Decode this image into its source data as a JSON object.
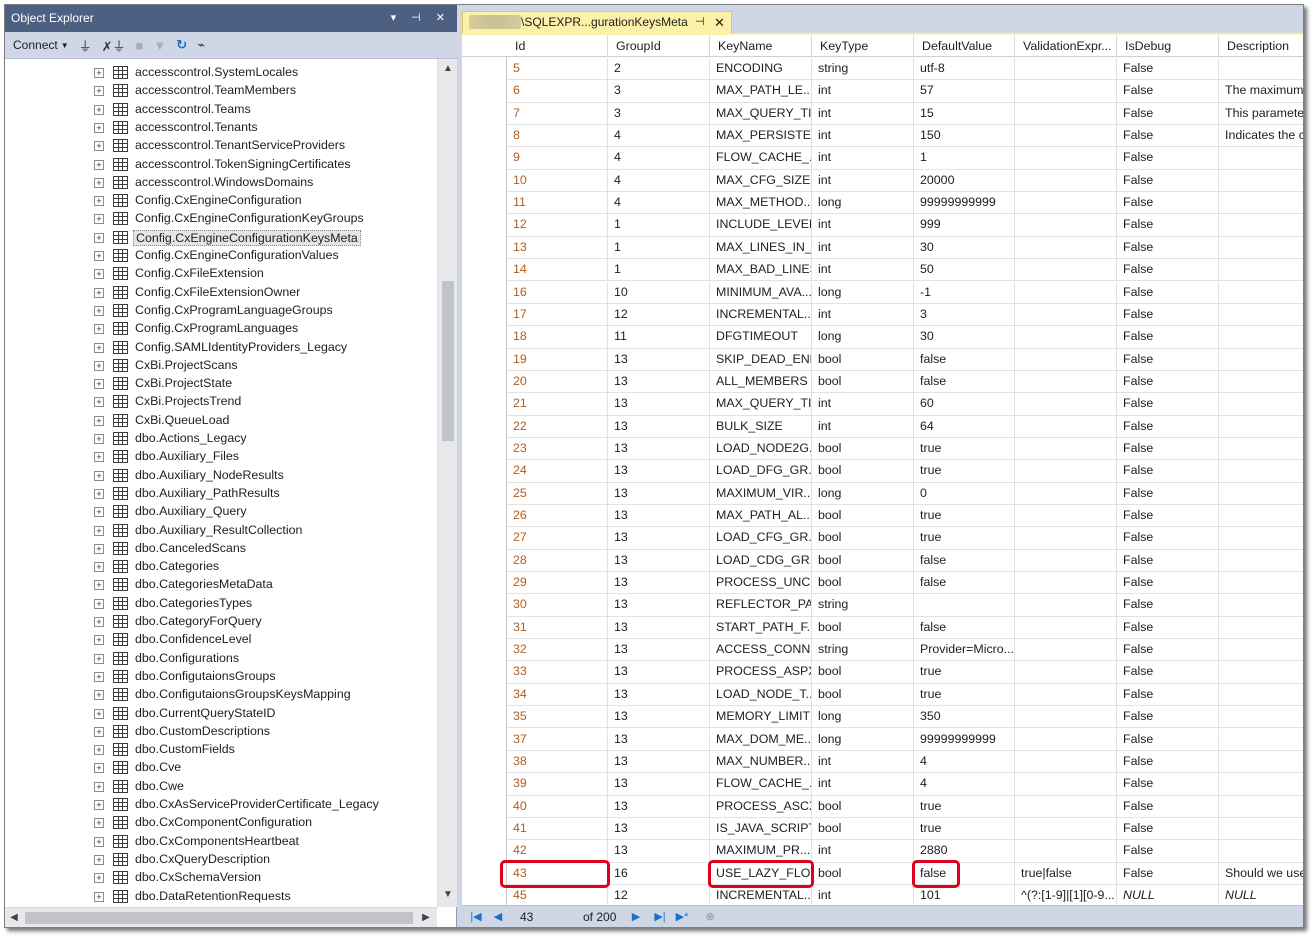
{
  "object_explorer": {
    "title": "Object Explorer",
    "title_controls": "▾ ⊣ ✕",
    "connect_label": "Connect",
    "tree_items": [
      "accesscontrol.SystemLocales",
      "accesscontrol.TeamMembers",
      "accesscontrol.Teams",
      "accesscontrol.Tenants",
      "accesscontrol.TenantServiceProviders",
      "accesscontrol.TokenSigningCertificates",
      "accesscontrol.WindowsDomains",
      "Config.CxEngineConfiguration",
      "Config.CxEngineConfigurationKeyGroups",
      "Config.CxEngineConfigurationKeysMeta",
      "Config.CxEngineConfigurationValues",
      "Config.CxFileExtension",
      "Config.CxFileExtensionOwner",
      "Config.CxProgramLanguageGroups",
      "Config.CxProgramLanguages",
      "Config.SAMLIdentityProviders_Legacy",
      "CxBi.ProjectScans",
      "CxBi.ProjectState",
      "CxBi.ProjectsTrend",
      "CxBi.QueueLoad",
      "dbo.Actions_Legacy",
      "dbo.Auxiliary_Files",
      "dbo.Auxiliary_NodeResults",
      "dbo.Auxiliary_PathResults",
      "dbo.Auxiliary_Query",
      "dbo.Auxiliary_ResultCollection",
      "dbo.CanceledScans",
      "dbo.Categories",
      "dbo.CategoriesMetaData",
      "dbo.CategoriesTypes",
      "dbo.CategoryForQuery",
      "dbo.ConfidenceLevel",
      "dbo.Configurations",
      "dbo.ConfigutaionsGroups",
      "dbo.ConfigutaionsGroupsKeysMapping",
      "dbo.CurrentQueryStateID",
      "dbo.CustomDescriptions",
      "dbo.CustomFields",
      "dbo.Cve",
      "dbo.Cwe",
      "dbo.CxAsServiceProviderCertificate_Legacy",
      "dbo.CxComponentConfiguration",
      "dbo.CxComponentsHeartbeat",
      "dbo.CxQueryDescription",
      "dbo.CxSchemaVersion",
      "dbo.DataRetentionRequests"
    ],
    "selected_item": "Config.CxEngineConfigurationKeysMeta"
  },
  "document": {
    "tab_title": "\\SQLEXPR...gurationKeysMeta",
    "columns": [
      "Id",
      "GroupId",
      "KeyName",
      "KeyType",
      "DefaultValue",
      "ValidationExpr...",
      "IsDebug",
      "Description"
    ],
    "rows": [
      [
        "5",
        "2",
        "ENCODING",
        "string",
        "utf-8",
        "",
        "False",
        ""
      ],
      [
        "6",
        "3",
        "MAX_PATH_LE...",
        "int",
        "57",
        "",
        "False",
        "The maximum"
      ],
      [
        "7",
        "3",
        "MAX_QUERY_TI...",
        "int",
        "15",
        "",
        "False",
        "This parameter"
      ],
      [
        "8",
        "4",
        "MAX_PERSISTE...",
        "int",
        "150",
        "",
        "False",
        "Indicates the ca"
      ],
      [
        "9",
        "4",
        "FLOW_CACHE_...",
        "int",
        "1",
        "",
        "False",
        ""
      ],
      [
        "10",
        "4",
        "MAX_CFG_SIZE",
        "int",
        "20000",
        "",
        "False",
        ""
      ],
      [
        "11",
        "4",
        "MAX_METHOD...",
        "long",
        "99999999999",
        "",
        "False",
        ""
      ],
      [
        "12",
        "1",
        "INCLUDE_LEVEL",
        "int",
        "999",
        "",
        "False",
        ""
      ],
      [
        "13",
        "1",
        "MAX_LINES_IN_...",
        "int",
        "30",
        "",
        "False",
        ""
      ],
      [
        "14",
        "1",
        "MAX_BAD_LINES",
        "int",
        "50",
        "",
        "False",
        ""
      ],
      [
        "16",
        "10",
        "MINIMUM_AVA...",
        "long",
        "-1",
        "",
        "False",
        ""
      ],
      [
        "17",
        "12",
        "INCREMENTAL...",
        "int",
        "3",
        "",
        "False",
        ""
      ],
      [
        "18",
        "11",
        "DFGTIMEOUT",
        "long",
        "30",
        "",
        "False",
        ""
      ],
      [
        "19",
        "13",
        "SKIP_DEAD_END",
        "bool",
        "false",
        "",
        "False",
        ""
      ],
      [
        "20",
        "13",
        "ALL_MEMBERS",
        "bool",
        "false",
        "",
        "False",
        ""
      ],
      [
        "21",
        "13",
        "MAX_QUERY_TI...",
        "int",
        "60",
        "",
        "False",
        ""
      ],
      [
        "22",
        "13",
        "BULK_SIZE",
        "int",
        "64",
        "",
        "False",
        ""
      ],
      [
        "23",
        "13",
        "LOAD_NODE2G...",
        "bool",
        "true",
        "",
        "False",
        ""
      ],
      [
        "24",
        "13",
        "LOAD_DFG_GR...",
        "bool",
        "true",
        "",
        "False",
        ""
      ],
      [
        "25",
        "13",
        "MAXIMUM_VIR...",
        "long",
        "0",
        "",
        "False",
        ""
      ],
      [
        "26",
        "13",
        "MAX_PATH_AL...",
        "bool",
        "true",
        "",
        "False",
        ""
      ],
      [
        "27",
        "13",
        "LOAD_CFG_GR...",
        "bool",
        "true",
        "",
        "False",
        ""
      ],
      [
        "28",
        "13",
        "LOAD_CDG_GR...",
        "bool",
        "false",
        "",
        "False",
        ""
      ],
      [
        "29",
        "13",
        "PROCESS_UNC...",
        "bool",
        "false",
        "",
        "False",
        ""
      ],
      [
        "30",
        "13",
        "REFLECTOR_PA...",
        "string",
        "",
        "",
        "False",
        ""
      ],
      [
        "31",
        "13",
        "START_PATH_F...",
        "bool",
        "false",
        "",
        "False",
        ""
      ],
      [
        "32",
        "13",
        "ACCESS_CONN...",
        "string",
        "Provider=Micro...",
        "",
        "False",
        ""
      ],
      [
        "33",
        "13",
        "PROCESS_ASPX",
        "bool",
        "true",
        "",
        "False",
        ""
      ],
      [
        "34",
        "13",
        "LOAD_NODE_T...",
        "bool",
        "true",
        "",
        "False",
        ""
      ],
      [
        "35",
        "13",
        "MEMORY_LIMIT",
        "long",
        "350",
        "",
        "False",
        ""
      ],
      [
        "37",
        "13",
        "MAX_DOM_ME...",
        "long",
        "99999999999",
        "",
        "False",
        ""
      ],
      [
        "38",
        "13",
        "MAX_NUMBER...",
        "int",
        "4",
        "",
        "False",
        ""
      ],
      [
        "39",
        "13",
        "FLOW_CACHE_...",
        "int",
        "4",
        "",
        "False",
        ""
      ],
      [
        "40",
        "13",
        "PROCESS_ASCX",
        "bool",
        "true",
        "",
        "False",
        ""
      ],
      [
        "41",
        "13",
        "IS_JAVA_SCRIPT...",
        "bool",
        "true",
        "",
        "False",
        ""
      ],
      [
        "42",
        "13",
        "MAXIMUM_PR...",
        "int",
        "2880",
        "",
        "False",
        ""
      ],
      [
        "43",
        "16",
        "USE_LAZY_FLOW",
        "bool",
        "false",
        "true|false",
        "False",
        "Should we use"
      ],
      [
        "45",
        "12",
        "INCREMENTAL...",
        "int",
        "101",
        "^(?:[1-9]|[1][0-9...",
        "NULL",
        "NULL"
      ]
    ],
    "navigator": {
      "position": "43",
      "of_label": "of 200"
    }
  }
}
